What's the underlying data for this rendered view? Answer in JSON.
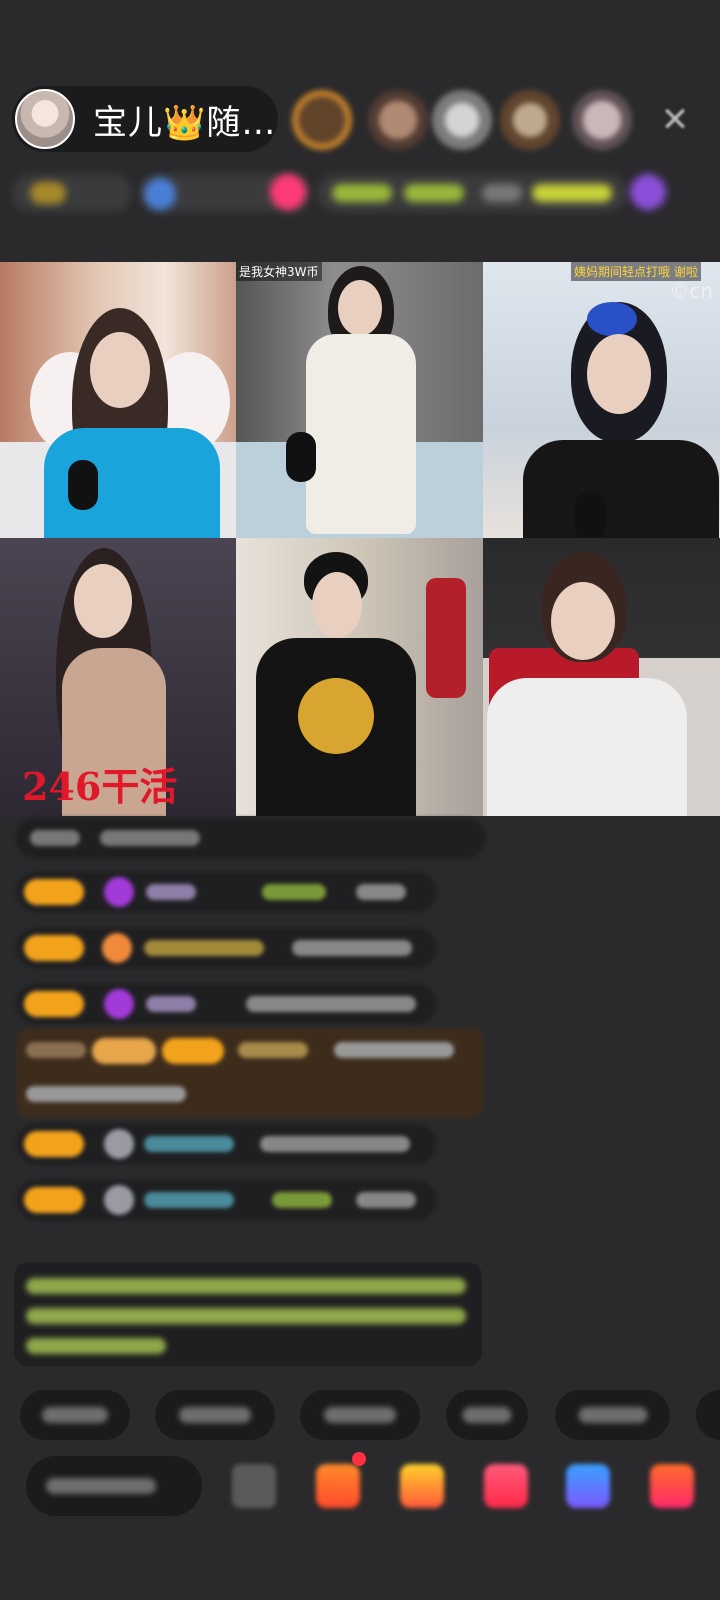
{
  "header": {
    "host_name": "宝儿👑随…",
    "close_label": "✕"
  },
  "grid": {
    "tiles": [
      {
        "label": ""
      },
      {
        "label": "是我女神3W币"
      },
      {
        "label": "姨妈期间轻点打哦 谢啦"
      },
      {
        "overlay": "246干活"
      },
      {
        "label": ""
      },
      {
        "label": ""
      }
    ],
    "watermark": "©cn"
  },
  "colors": {
    "background": "#2a2a2c",
    "badge": "#f3a31b",
    "accent_pink": "#ff3c78"
  },
  "icons": {
    "close": "close-icon",
    "gift": "gift-icon",
    "more": "more-icon"
  }
}
